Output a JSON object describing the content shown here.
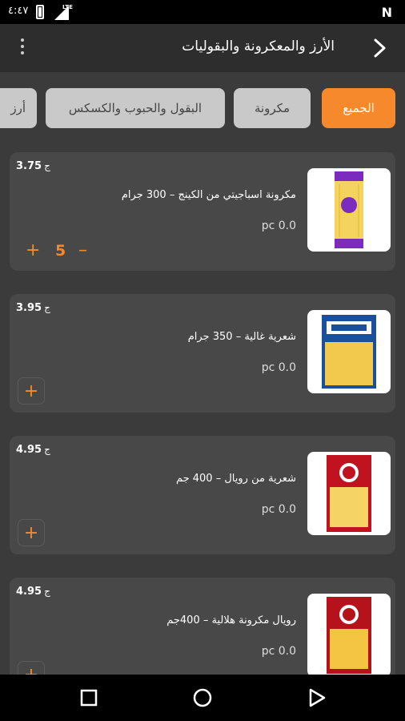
{
  "status": {
    "time": "٤:٤٧",
    "network": "LTE"
  },
  "header": {
    "title": "الأرز والمعكرونة والبقوليات"
  },
  "chips": [
    {
      "label": "الجميع",
      "active": true
    },
    {
      "label": "مكرونة",
      "active": false
    },
    {
      "label": "البقول والحبوب والكسكس",
      "active": false
    },
    {
      "label": "أرز",
      "active": false
    }
  ],
  "products": [
    {
      "currency": "ج",
      "price": "3.75",
      "name": "مكرونة اسباجيتي من الكينج – 300 جرام",
      "qty": "pc 0.0",
      "count": "5",
      "thumb": "spaghetti-pack"
    },
    {
      "currency": "ج",
      "price": "3.95",
      "name": "شعرية غالية – 350 جرام",
      "qty": "pc 0.0",
      "thumb": "vermicelli-pack"
    },
    {
      "currency": "ج",
      "price": "4.95",
      "name": "شعرية من رويال – 400 جم",
      "qty": "pc 0.0",
      "thumb": "royal-vermicelli-pack"
    },
    {
      "currency": "ج",
      "price": "4.95",
      "name": "رويال مكرونة هلالية – 400جم",
      "qty": "pc 0.0",
      "thumb": "royal-pasta-pack"
    }
  ],
  "colors": {
    "accent": "#f7892d",
    "card": "#484848",
    "background": "#3b3b3b",
    "header": "#2d2d2d"
  }
}
